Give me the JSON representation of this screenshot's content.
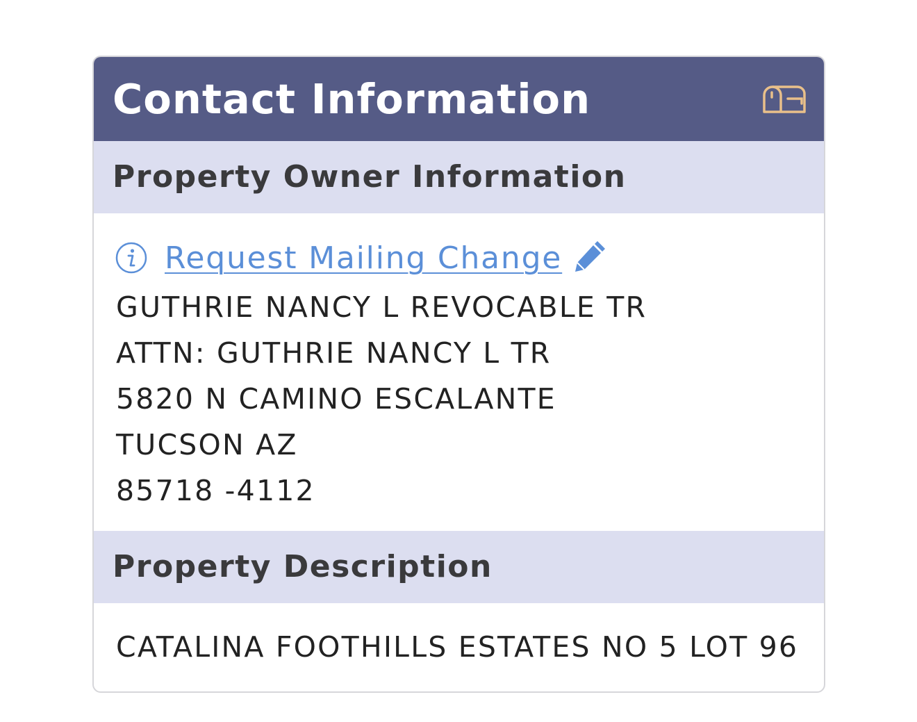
{
  "card": {
    "title": "Contact Information",
    "header_icon": "mailbox-icon"
  },
  "owner_section": {
    "title": "Property Owner Information",
    "info_icon": "info-icon",
    "mailing_link_label": "Request Mailing Change",
    "edit_icon": "pencil-icon",
    "lines": [
      "GUTHRIE NANCY L REVOCABLE TR",
      "ATTN: GUTHRIE NANCY L TR",
      "5820 N CAMINO ESCALANTE",
      "TUCSON AZ",
      "85718 -4112"
    ]
  },
  "description_section": {
    "title": "Property Description",
    "text": "CATALINA FOOTHILLS ESTATES NO 5 LOT 96"
  },
  "colors": {
    "header_bg": "#555b86",
    "section_bg": "#dcdef0",
    "link": "#5b8fd8",
    "mailbox_icon": "#e9c08a"
  }
}
